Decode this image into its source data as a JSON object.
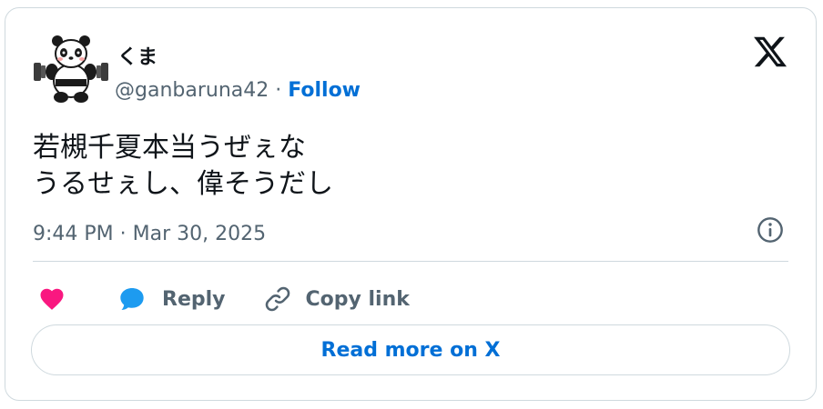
{
  "author": {
    "display_name": "くま",
    "handle": "@ganbaruna42",
    "separator": " · ",
    "follow_label": "Follow"
  },
  "tweet": {
    "text": "若槻千夏本当うぜぇな\nうるせぇし、偉そうだし",
    "timestamp": "9:44 PM · Mar 30, 2025"
  },
  "actions": {
    "reply_label": "Reply",
    "copy_link_label": "Copy link",
    "read_more_label": "Read more on X"
  },
  "icons": {
    "like": "heart-icon",
    "reply": "speech-bubble-icon",
    "copy": "link-icon",
    "info": "info-icon",
    "brand": "x-logo"
  },
  "colors": {
    "link_blue": "#006fd6",
    "heart_pink": "#f91880",
    "reply_blue": "#1d9bf0",
    "muted_text": "#536471",
    "border": "#cfd9de"
  }
}
